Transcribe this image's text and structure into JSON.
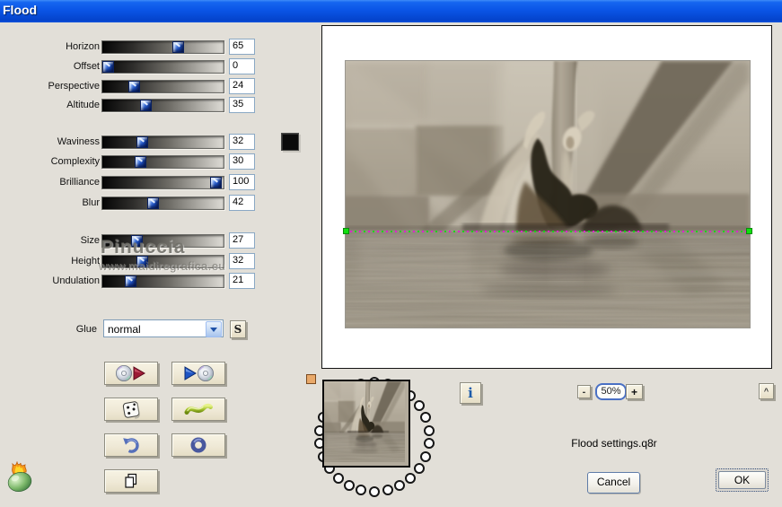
{
  "window": {
    "title": "Flood"
  },
  "sliders": [
    {
      "label": "Horizon",
      "value": 65
    },
    {
      "label": "Offset",
      "value": 0
    },
    {
      "label": "Perspective",
      "value": 24
    },
    {
      "label": "Altitude",
      "value": 35
    },
    {
      "label": "Waviness",
      "value": 32
    },
    {
      "label": "Complexity",
      "value": 30
    },
    {
      "label": "Brilliance",
      "value": 100
    },
    {
      "label": "Blur",
      "value": 42
    },
    {
      "label": "Size",
      "value": 27
    },
    {
      "label": "Height",
      "value": 32
    },
    {
      "label": "Undulation",
      "value": 21
    }
  ],
  "swatch": {
    "color": "#0a0a0a"
  },
  "watermark": {
    "line1": "Pinuccia",
    "line2": "www.maidiregrafica.eu"
  },
  "glue": {
    "label": "Glue",
    "value": "normal",
    "s_button": "S"
  },
  "icons": {
    "save_settings": "cd-export-icon",
    "load_settings": "cd-import-icon",
    "randomize": "dice-icon",
    "wave": "wave-icon",
    "undo": "undo-icon",
    "ring": "ring-icon",
    "copy": "copy-icon",
    "logo": "flaming-pear-logo"
  },
  "preview": {
    "zoom": {
      "minus": "-",
      "level": "50%",
      "plus": "+",
      "collapse": "^"
    },
    "info_button": "i",
    "settings_filename": "Flood settings.q8r",
    "memory_dots": 26,
    "horizon_colors": {
      "dot_green": "#17d817",
      "dot_magenta": "#e01ed0"
    }
  },
  "actions": {
    "cancel": "Cancel",
    "ok": "OK"
  },
  "accent": {
    "titlebar_blue": "#0a55e6",
    "handle_blue": "#1c4fc0"
  }
}
